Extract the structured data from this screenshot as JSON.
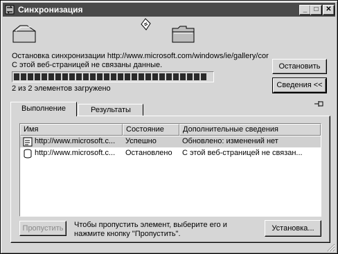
{
  "window": {
    "title": "Синхронизация",
    "min": "_",
    "max": "□",
    "close": "✕"
  },
  "status": {
    "line1": "Остановка синхронизации http://www.microsoft.com/windows/ie/gallery/cor",
    "line2": "С этой веб-страницей не связаны данные.",
    "progress_text": "2 из 2 элементов загружено",
    "progress_fraction": 1.0
  },
  "buttons": {
    "stop": "Остановить",
    "details": "Сведения <<",
    "skip": "Пропустить",
    "settings": "Установка..."
  },
  "tabs": [
    {
      "label": "Выполнение",
      "active": true
    },
    {
      "label": "Результаты",
      "active": false
    }
  ],
  "table": {
    "columns": [
      "Имя",
      "Состояние",
      "Дополнительные сведения"
    ],
    "rows": [
      {
        "icon": "page-sync-icon",
        "name": "http://www.microsoft.c...",
        "state": "Успешно",
        "info": "Обновлено: изменений нет"
      },
      {
        "icon": "cylinder-icon",
        "name": "http://www.microsoft.c...",
        "state": "Остановлено",
        "info": "С этой веб-страницей не связан..."
      }
    ]
  },
  "hint": {
    "line1": "Чтобы пропустить элемент, выберите его и",
    "line2": "нажмите кнопку \"Пропустить\"."
  },
  "icons": [
    "sync-title-icon",
    "folder-source-icon",
    "flying-page-icon",
    "folder-dest-icon",
    "pin-icon"
  ]
}
